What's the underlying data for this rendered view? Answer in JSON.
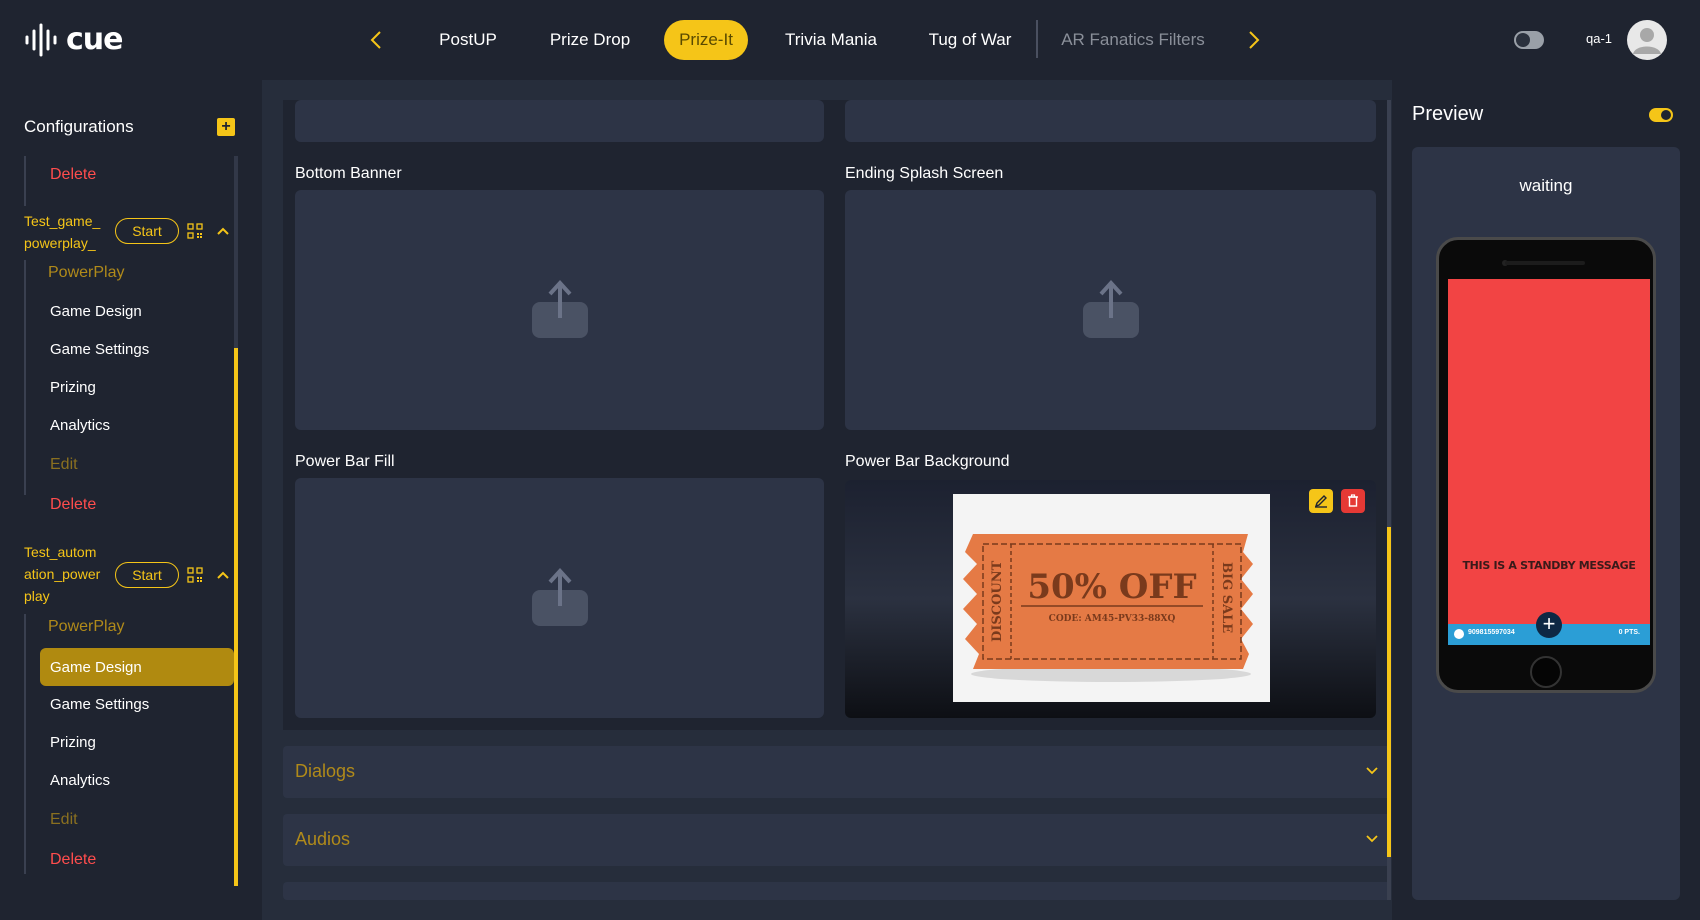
{
  "app": {
    "logo_text": "cue",
    "user_label": "qa-1"
  },
  "top_tabs": [
    {
      "label": "PostUP"
    },
    {
      "label": "Prize Drop"
    },
    {
      "label": "Prize-It"
    },
    {
      "label": "Trivia Mania"
    },
    {
      "label": "Tug of War"
    },
    {
      "label": "AR Fanatics Filters"
    }
  ],
  "active_tab": "Prize-It",
  "sidebar": {
    "title": "Configurations",
    "top_delete": "Delete",
    "games": [
      {
        "name": "Test_game_ powerplay_",
        "start_label": "Start",
        "type": "PowerPlay",
        "items": [
          "Game Design",
          "Game Settings",
          "Prizing",
          "Analytics"
        ],
        "edit_label": "Edit",
        "delete_label": "Delete"
      },
      {
        "name": "Test_autom ation_power play",
        "start_label": "Start",
        "type": "PowerPlay",
        "items": [
          "Game Design",
          "Game Settings",
          "Prizing",
          "Analytics"
        ],
        "edit_label": "Edit",
        "delete_label": "Delete",
        "active_item": "Game Design"
      }
    ]
  },
  "main": {
    "boxes": {
      "bottom_banner": "Bottom Banner",
      "ending_splash": "Ending Splash Screen",
      "power_bar_fill": "Power Bar Fill",
      "power_bar_background": "Power Bar Background"
    },
    "coupon": {
      "left_text": "DISCOUNT",
      "main_text": "50% OFF",
      "code_text": "CODE: AM45-PV33-88XQ",
      "right_text": "BIG SALE"
    },
    "accordions": [
      "Dialogs",
      "Audios"
    ]
  },
  "preview": {
    "title": "Preview",
    "status": "waiting",
    "standby_message": "THIS IS A STANDBY MESSAGE",
    "phone_id": "909815597034",
    "phone_points": "0 PTS."
  },
  "colors": {
    "accent": "#f5c518",
    "background": "#1f2430",
    "panel": "#2d3446",
    "danger": "#ff4d4d",
    "phone_screen": "#f24444",
    "phone_bar": "#2b9ed6"
  }
}
